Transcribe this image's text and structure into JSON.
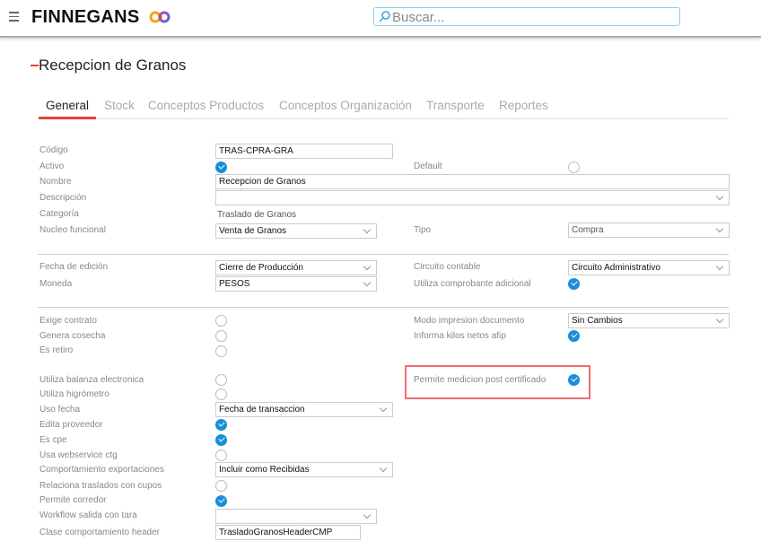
{
  "header": {
    "brand": "FINNEGANS",
    "search_placeholder": "Buscar..."
  },
  "page": {
    "title": "Recepcion de Granos"
  },
  "tabs": [
    "General",
    "Stock",
    "Conceptos Productos",
    "Conceptos Organización",
    "Transporte",
    "Reportes"
  ],
  "form": {
    "codigo": {
      "label": "Código",
      "value": "TRAS-CPRA-GRA"
    },
    "activo": {
      "label": "Activo",
      "checked": true
    },
    "default": {
      "label": "Default",
      "checked": false
    },
    "nombre": {
      "label": "Nombre",
      "value": "Recepcion de Granos"
    },
    "descripcion": {
      "label": "Descripción",
      "value": ""
    },
    "categoria": {
      "label": "Categoría",
      "value": "Traslado de Granos"
    },
    "nucleo": {
      "label": "Nucleo funcional",
      "value": "Venta de Granos"
    },
    "tipo": {
      "label": "Tipo",
      "value": "Compra"
    },
    "fecha_edicion": {
      "label": "Fecha de edición",
      "value": "Cierre de Producción"
    },
    "circuito": {
      "label": "Circuito contable",
      "value": "Circuito Administrativo"
    },
    "moneda": {
      "label": "Moneda",
      "value": "PESOS"
    },
    "comprobante_adicional": {
      "label": "Utiliza comprobante adicional",
      "checked": true
    },
    "exige_contrato": {
      "label": "Exige contrato",
      "checked": false
    },
    "modo_impresion": {
      "label": "Modo impresion documento",
      "value": "Sin Cambios"
    },
    "genera_cosecha": {
      "label": "Genera cosecha",
      "checked": false
    },
    "kilos_netos": {
      "label": "Informa kilos netos afip",
      "checked": true
    },
    "es_retiro": {
      "label": "Es retiro",
      "checked": false
    },
    "balanza": {
      "label": "Utiliza balanza electronica",
      "checked": false
    },
    "medicion_post": {
      "label": "Permite medicion post certificado",
      "checked": true
    },
    "higrometro": {
      "label": "Utiliza higrómetro",
      "checked": false
    },
    "uso_fecha": {
      "label": "Uso fecha",
      "value": "Fecha de transaccion"
    },
    "edita_proveedor": {
      "label": "Edita proveedor",
      "checked": true
    },
    "es_cpe": {
      "label": "Es cpe",
      "checked": true
    },
    "usa_ws": {
      "label": "Usa webservice ctg",
      "checked": false
    },
    "comportamiento_export": {
      "label": "Comportamiento exportaciones",
      "value": "Incluir como Recibidas"
    },
    "relaciona_cupos": {
      "label": "Relaciona traslados con cupos",
      "checked": false
    },
    "permite_corredor": {
      "label": "Permite corredor",
      "checked": true
    },
    "workflow": {
      "label": "Workflow salida con tara",
      "value": ""
    },
    "clase_header": {
      "label": "Clase comportamiento header",
      "value": "TrasladoGranosHeaderCMP"
    }
  }
}
